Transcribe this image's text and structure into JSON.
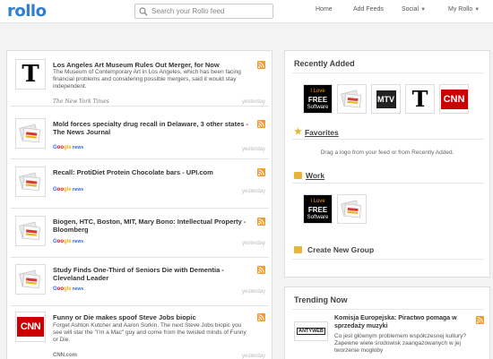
{
  "app": {
    "logo_text": "rollo"
  },
  "search": {
    "placeholder": "Search your Rollo feed"
  },
  "nav": {
    "home": "Home",
    "add_feeds": "Add Feeds",
    "social": "Social",
    "my_rollo": "My Rollo"
  },
  "feed": [
    {
      "title": "Los Angeles Art Museum Rules Out Merger, for Now",
      "description": "The Museum of Contemporary Art in Los Angeles, which has been facing financial problems and considering possible mergers, said it would stay independent.",
      "source": "The New York Times",
      "time": "yesterday",
      "thumb": "nyt-logo-icon"
    },
    {
      "title": "Mold forces specialty drug recall in Delaware, 3 other states - The News Journal",
      "description": "",
      "source": "Google news",
      "time": "yesterday",
      "thumb": "google-news-icon"
    },
    {
      "title": "Recall: ProtiDiet Protein Chocolate bars - UPI.com",
      "description": "",
      "source": "Google news",
      "time": "yesterday",
      "thumb": "google-news-icon"
    },
    {
      "title": "Biogen, HTC, Boston, MIT, Mary Bono: Intellectual Property - Bloomberg",
      "description": "",
      "source": "Google news",
      "time": "yesterday",
      "thumb": "google-news-icon"
    },
    {
      "title": "Study Finds One-Third of Seniors Die with Dementia - Cleveland Leader",
      "description": "",
      "source": "Google news",
      "time": "yesterday",
      "thumb": "google-news-icon"
    },
    {
      "title": "Funny or Die makes spoof Steve Jobs biopic",
      "description": "Forget Ashton Kutcher and Aaron Sorkin. The next Steve Jobs biopic you see will star the \"I'm a Mac\" guy and come from the twisted minds of Funny or Die.",
      "source": "CNN.com",
      "time": "yesterday",
      "thumb": "cnn-logo-icon"
    }
  ],
  "sidebar": {
    "recently_added_title": "Recently Added",
    "recently_added": [
      "i-love-free-software-logo",
      "google-news-logo",
      "mtv-logo",
      "nyt-logo",
      "cnn-logo"
    ],
    "favorites_title": "Favorites",
    "favorites_hint": "Drag a logo from your feed or from Recently Added.",
    "work_title": "Work",
    "work_items": [
      "i-love-free-software-logo",
      "google-news-logo"
    ],
    "create_group": "Create New Group",
    "trending_title": "Trending Now",
    "trending": [
      {
        "title": "Komisja Europejska: Piractwo pomaga w sprzedaży muzyki",
        "description": "Co jest głównym problemem współczesnej kultury? Zapewne wiele środowisk zaangażowanych w jej tworzenie mogłoby",
        "logo_text": "ANTYWEB"
      }
    ]
  },
  "logos": {
    "love_text_1": "I Love",
    "love_text_2": "FREE",
    "love_text_3": "Software",
    "mtv": "MTV",
    "cnn": "CNN",
    "nyt": "T",
    "nyt_source": "The New York Times",
    "google_g": "G",
    "google_rest_1": "oo",
    "google_rest_2": "gle",
    "google_news": "news",
    "cnn_source": "CNN.com"
  },
  "colors": {
    "brand": "#2f7fcf",
    "rss": "#f39a2c",
    "cnn_red": "#cc0000"
  }
}
